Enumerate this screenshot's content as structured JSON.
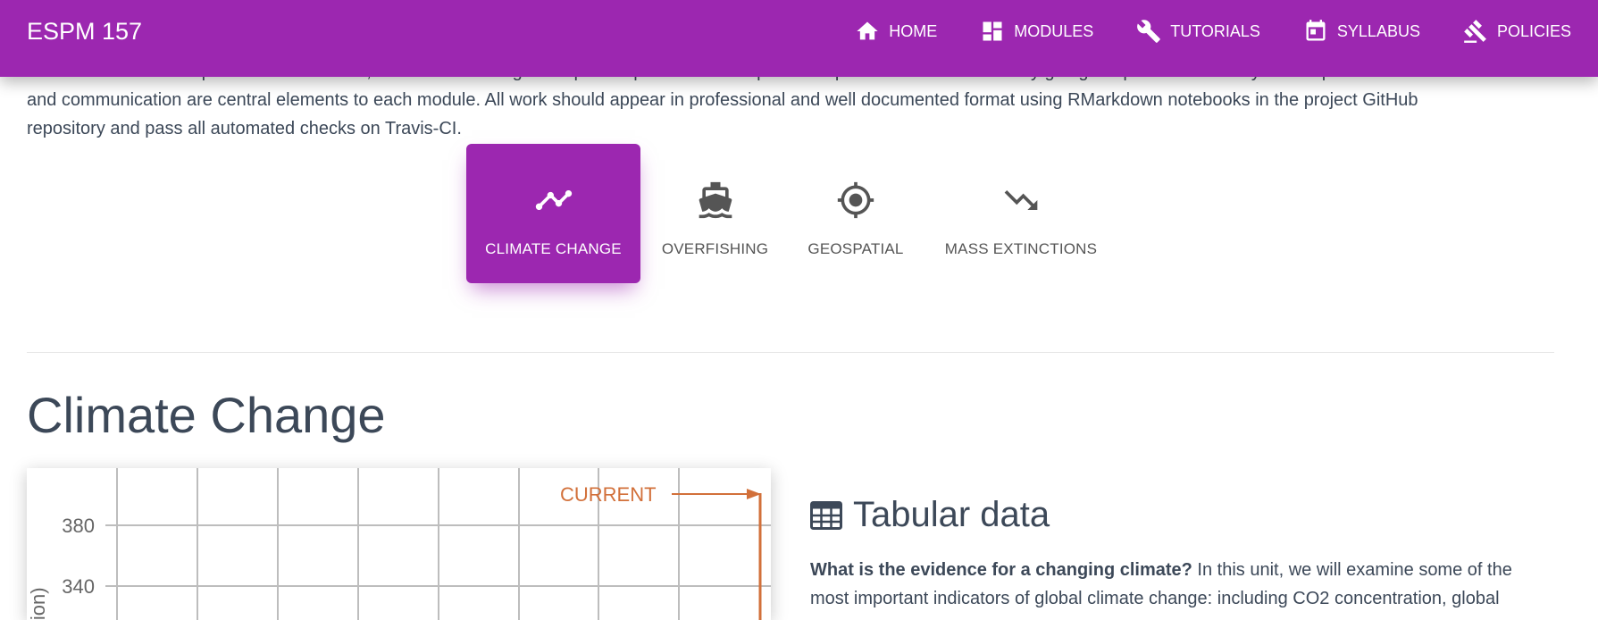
{
  "navbar": {
    "brand": "ESPM 157",
    "items": [
      {
        "label": "HOME",
        "icon": "home-icon"
      },
      {
        "label": "MODULES",
        "icon": "dashboard-icon"
      },
      {
        "label": "TUTORIALS",
        "icon": "wrench-icon"
      },
      {
        "label": "SYLLABUS",
        "icon": "calendar-icon"
      },
      {
        "label": "POLICIES",
        "icon": "gavel-icon"
      }
    ],
    "bg_color": "#9c27b0"
  },
  "intro": {
    "line1": "should be able to complete initial exercises, while teams with greater prior experience are expected to push these boundaries by going deeper into the analysis and presentation. Workflow",
    "line2": "and communication are central elements to each module. All work should appear in professional and well documented format using RMarkdown notebooks in the project GitHub",
    "line3": "repository and pass all automated checks on Travis-CI."
  },
  "module_tabs": [
    {
      "label": "CLIMATE CHANGE",
      "icon": "timeline-icon",
      "active": true
    },
    {
      "label": "OVERFISHING",
      "icon": "ship-icon",
      "active": false
    },
    {
      "label": "GEOSPATIAL",
      "icon": "crosshair-icon",
      "active": false
    },
    {
      "label": "MASS EXTINCTIONS",
      "icon": "trending-down-icon",
      "active": false
    }
  ],
  "section": {
    "title": "Climate Change"
  },
  "chart_data": {
    "type": "line",
    "annotation": "CURRENT",
    "ylabel_visible": "lion)",
    "yticks": [
      340,
      380
    ],
    "grid": true,
    "accent_color": "#d2703a"
  },
  "tabular": {
    "heading": "Tabular data",
    "icon": "table-icon",
    "question": "What is the evidence for a changing climate?",
    "line1_rest": " In this unit, we will examine some of the",
    "line2": "most important indicators of global climate change: including CO2 concentration, global"
  }
}
